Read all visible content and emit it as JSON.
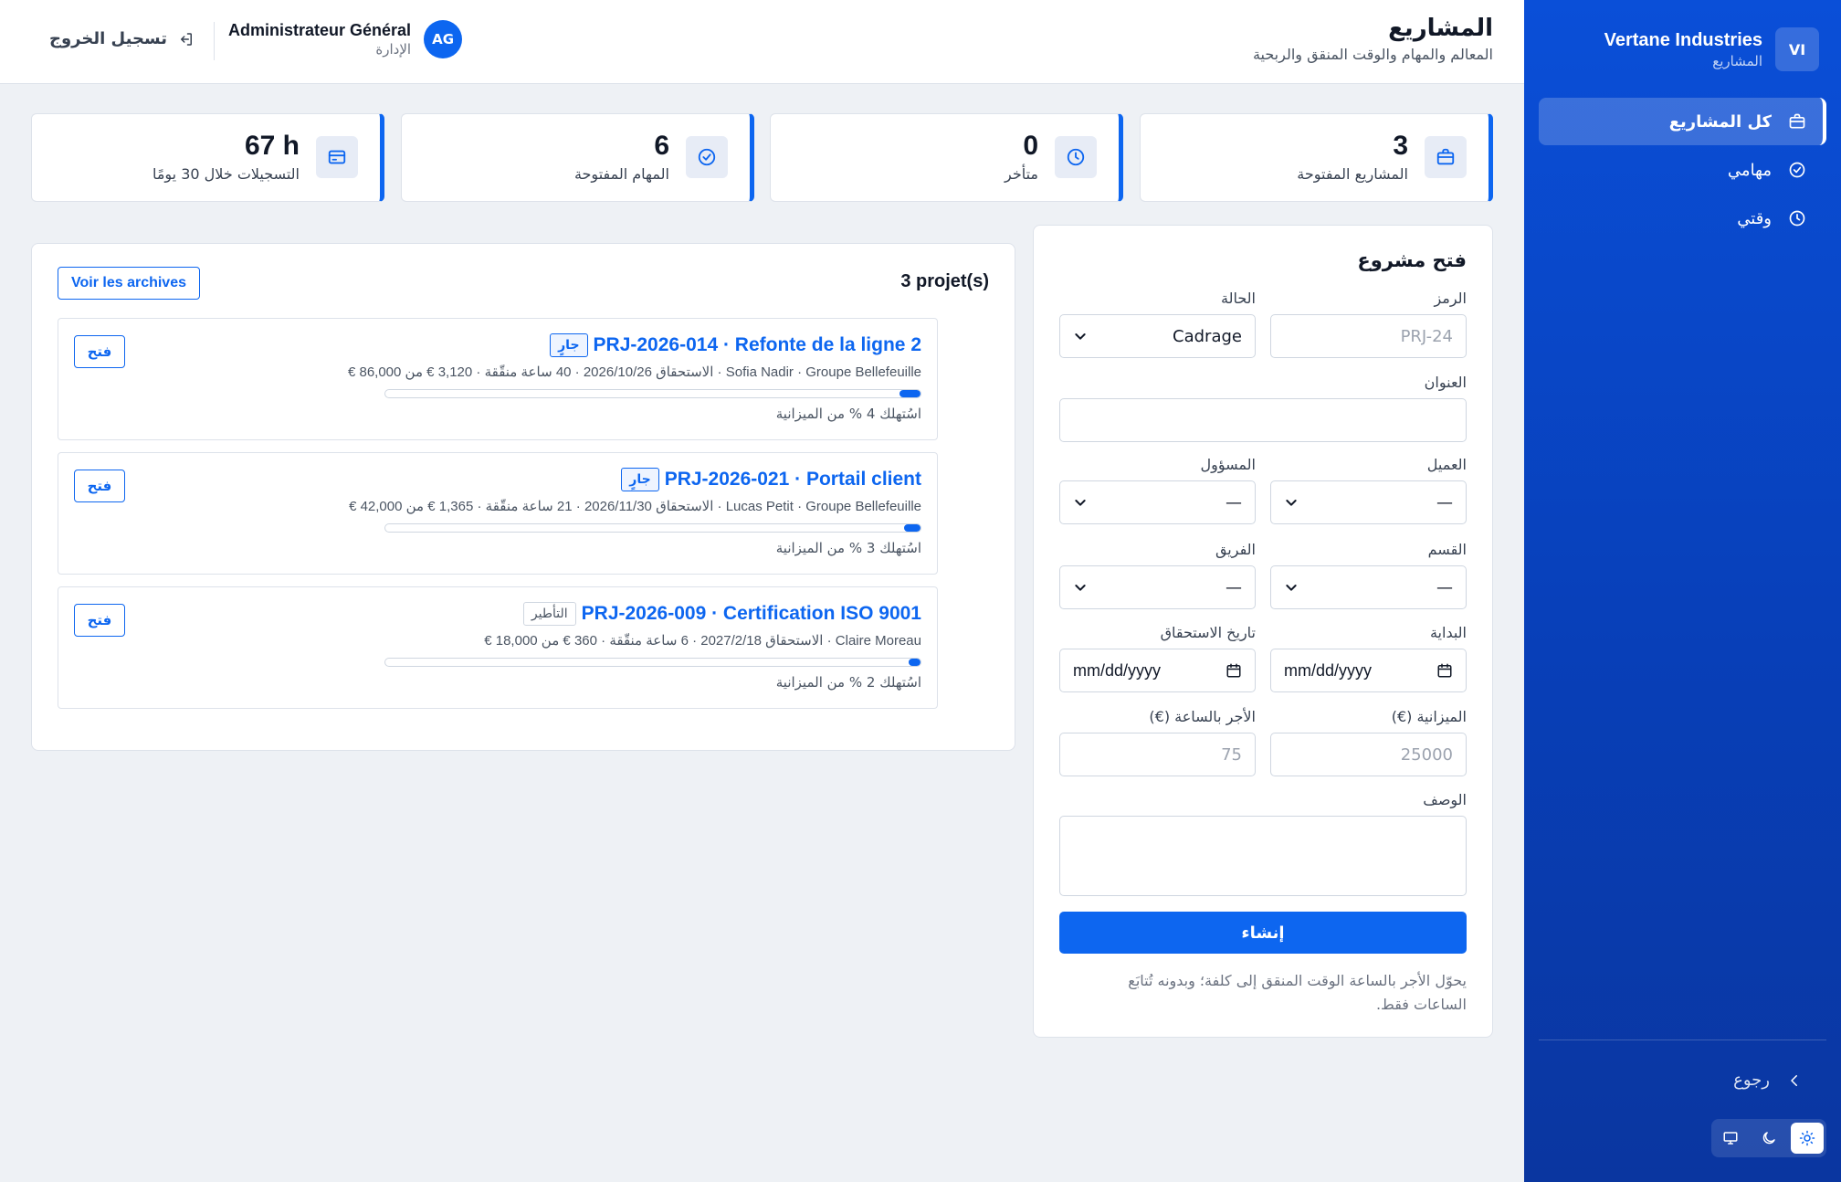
{
  "sidebar": {
    "brand_initials": "VI",
    "brand_name": "Vertane Industries",
    "brand_sub": "المشاريع",
    "items": [
      {
        "label": "كل المشاريع",
        "icon": "briefcase-icon",
        "active": true
      },
      {
        "label": "مهامي",
        "icon": "check-circle-icon"
      },
      {
        "label": "وقتي",
        "icon": "clock-icon"
      }
    ],
    "back_label": "رجوع",
    "theme_options": [
      "light",
      "dark",
      "system"
    ]
  },
  "header": {
    "title": "المشاريع",
    "subtitle": "المعالم والمهام والوقت المنقق والربحية",
    "user_initials": "AG",
    "user_name": "Administrateur Général",
    "user_role": "الإدارة",
    "logout_label": "تسجيل الخروج"
  },
  "stats": [
    {
      "value": "3",
      "label": "المشاريع المفتوحة",
      "icon": "briefcase-icon"
    },
    {
      "value": "0",
      "label": "متأخر",
      "icon": "clock-icon"
    },
    {
      "value": "6",
      "label": "المهام المفتوحة",
      "icon": "check-circle-icon"
    },
    {
      "value": "67 h",
      "label": "التسجيلات خلال 30 يومًا",
      "icon": "card-icon"
    }
  ],
  "form": {
    "title": "فتح مشروع",
    "code_label": "الرمز",
    "code_placeholder": "PRJ-24",
    "status_label": "الحالة",
    "status_value": "Cadrage",
    "title_label": "العنوان",
    "client_label": "العميل",
    "client_value": "—",
    "owner_label": "المسؤول",
    "owner_value": "—",
    "department_label": "القسم",
    "department_value": "—",
    "team_label": "الفريق",
    "team_value": "—",
    "start_label": "البداية",
    "start_value": "mm/dd/yyyy",
    "due_label": "تاريخ الاستحقاق",
    "due_value": "mm/dd/yyyy",
    "budget_label": "الميزانية (€)",
    "budget_placeholder": "25000",
    "rate_label": "الأجر بالساعة (€)",
    "rate_placeholder": "75",
    "description_label": "الوصف",
    "submit_label": "إنشاء",
    "hint": "يحوّل الأجر بالساعة الوقت المنقق إلى كلفة؛ وبدونه تُتابَع الساعات فقط."
  },
  "projects": {
    "count_label": "3 projet(s)",
    "archive_label": "Voir les archives",
    "open_label": "فتح",
    "items": [
      {
        "name": "PRJ-2026-014 · Refonte de la ligne 2",
        "status": "جارٍ",
        "status_style": "blue",
        "meta": "Sofia Nadir · Groupe Bellefeuille · الاستحقاق 2026/10/26 · 40 ساعة منقّقة · 3,120 € من 86,000 €",
        "budget_used": 0.04,
        "budget_text": "اسُتهلك 4 % من الميزانية"
      },
      {
        "name": "PRJ-2026-021 · Portail client",
        "status": "جارٍ",
        "status_style": "blue",
        "meta": "Lucas Petit · Groupe Bellefeuille · الاستحقاق 2026/11/30 · 21 ساعة منقّقة · 1,365 € من 42,000 €",
        "budget_used": 0.03,
        "budget_text": "اسُتهلك 3 % من الميزانية"
      },
      {
        "name": "PRJ-2026-009 · Certification ISO 9001",
        "status": "التأطير",
        "status_style": "gray",
        "meta": "Claire Moreau · الاستحقاق 2027/2/18 · 6 ساعة منقّقة · 360 € من 18,000 €",
        "budget_used": 0.02,
        "budget_text": "اسُتهلك 2 % من الميزانية"
      }
    ]
  },
  "colors": {
    "accent": "#0d66f0",
    "sidebar": "#0a4fd8",
    "background": "#eef1f5"
  }
}
